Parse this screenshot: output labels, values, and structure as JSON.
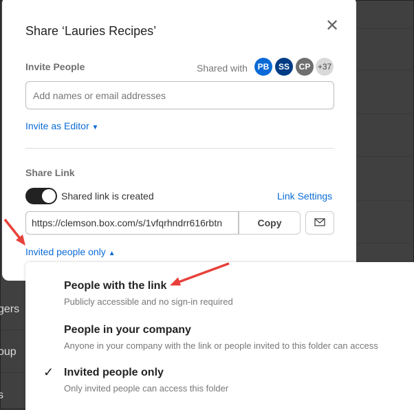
{
  "background": {
    "rows": [
      "gers",
      "oup",
      "s"
    ]
  },
  "dialog": {
    "title": "Share ‘Lauries Recipes’",
    "close_icon": "close-icon",
    "invite": {
      "label": "Invite People",
      "shared_with": "Shared with",
      "avatars": [
        {
          "initials": "PB",
          "color": "#0a6bd6"
        },
        {
          "initials": "SS",
          "color": "#003c84"
        },
        {
          "initials": "CP",
          "color": "#6f6f6f"
        },
        {
          "initials": "+37",
          "color": "#d9d9d9"
        }
      ],
      "placeholder": "Add names or email addresses",
      "role": "Invite as Editor"
    },
    "share_link": {
      "label": "Share Link",
      "toggle_label": "Shared link is created",
      "toggle_on": true,
      "settings": "Link Settings",
      "url": "https://clemson.box.com/s/1vfqrhndrr616rbtn",
      "copy": "Copy",
      "access": "Invited people only"
    }
  },
  "menu": {
    "options": [
      {
        "title": "People with the link",
        "desc": "Publicly accessible and no sign-in required",
        "selected": false
      },
      {
        "title": "People in your company",
        "desc": "Anyone in your company with the link or people invited to this folder can access",
        "selected": false
      },
      {
        "title": "Invited people only",
        "desc": "Only invited people can access this folder",
        "selected": true
      }
    ]
  },
  "accent": "#0a6bd6",
  "annotation_color": "#e8403a"
}
